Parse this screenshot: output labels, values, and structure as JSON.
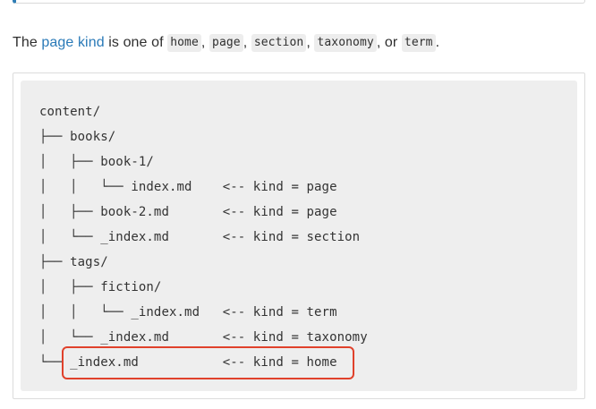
{
  "paragraph": {
    "prefix": "The ",
    "link": "page kind",
    "middle": " is one of ",
    "kinds": [
      "home",
      "page",
      "section",
      "taxonomy",
      "term"
    ],
    "sep1": ", ",
    "sep2": ", ",
    "sep3": ", ",
    "sep4": ", or ",
    "suffix": "."
  },
  "code_block": {
    "lines": [
      "content/",
      "├── books/",
      "│   ├── book-1/",
      "│   │   └── index.md    <-- kind = page",
      "│   ├── book-2.md       <-- kind = page",
      "│   └── _index.md       <-- kind = section",
      "├── tags/",
      "│   ├── fiction/",
      "│   │   └── _index.md   <-- kind = term",
      "│   └── _index.md       <-- kind = taxonomy",
      "└── _index.md           <-- kind = home"
    ]
  },
  "colors": {
    "link": "#2a7ab8",
    "highlight": "#e0412b",
    "code_background": "#eeeeee",
    "callout_accent": "#2f7db5"
  }
}
